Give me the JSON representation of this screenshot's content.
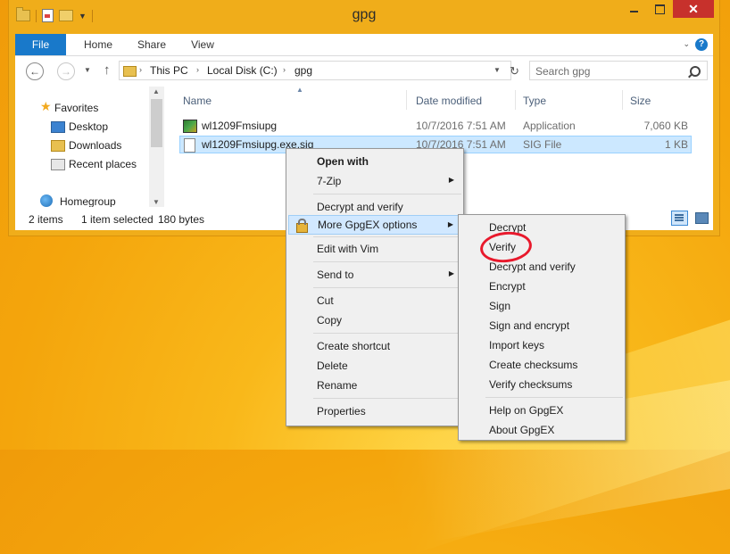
{
  "window": {
    "title": "gpg"
  },
  "ribbon": {
    "tabs": [
      "File",
      "Home",
      "Share",
      "View"
    ],
    "help": "?"
  },
  "address": {
    "crumbs": [
      "This PC",
      "Local Disk (C:)",
      "gpg"
    ],
    "search_placeholder": "Search gpg"
  },
  "nav_pane": {
    "favorites": "Favorites",
    "items": [
      "Desktop",
      "Downloads",
      "Recent places"
    ],
    "homegroup": "Homegroup"
  },
  "columns": {
    "name": "Name",
    "date": "Date modified",
    "type": "Type",
    "size": "Size"
  },
  "files": [
    {
      "name": "wl1209Fmsiupg",
      "date": "10/7/2016 7:51 AM",
      "type": "Application",
      "size": "7,060 KB"
    },
    {
      "name": "wl1209Fmsiupg.exe.sig",
      "date": "10/7/2016 7:51 AM",
      "type": "SIG File",
      "size": "1 KB"
    }
  ],
  "status": {
    "count": "2 items",
    "selected": "1 item selected",
    "bytes": "180 bytes"
  },
  "context_menu": {
    "open_with": "Open with",
    "seven_zip": "7-Zip",
    "decrypt_verify": "Decrypt and verify",
    "more_gpgex": "More GpgEX options",
    "edit_vim": "Edit with Vim",
    "send_to": "Send to",
    "cut": "Cut",
    "copy": "Copy",
    "create_shortcut": "Create shortcut",
    "delete": "Delete",
    "rename": "Rename",
    "properties": "Properties"
  },
  "submenu": {
    "items": [
      "Decrypt",
      "Verify",
      "Decrypt and verify",
      "Encrypt",
      "Sign",
      "Sign and encrypt",
      "Import keys",
      "Create checksums",
      "Verify checksums"
    ],
    "help": "Help on GpgEX",
    "about": "About GpgEX"
  },
  "annotation_color": "#e8192c"
}
